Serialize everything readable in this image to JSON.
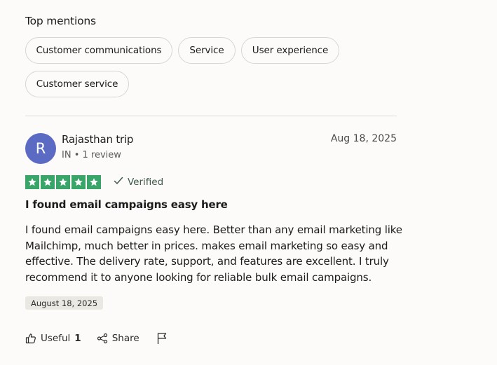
{
  "top_mentions": {
    "title": "Top mentions",
    "chips": [
      "Customer communications",
      "Service",
      "User experience",
      "Customer service"
    ]
  },
  "review": {
    "avatar_initial": "R",
    "author_name": "Rajasthan trip",
    "author_meta": "IN • 1 review",
    "date": "Aug 18, 2025",
    "rating": 5,
    "star_color": "#3aa569",
    "verified_label": "Verified",
    "title": "I found email campaigns easy here",
    "body": "I found email campaigns easy here. Better than any email marketing like Mailchimp, much better in prices. makes email marketing so easy and effective. The delivery rate, support, and features are excellent. I truly recommend it to anyone looking for reliable bulk email campaigns.",
    "experience_date": "August 18, 2025"
  },
  "actions": {
    "useful_label": "Useful",
    "useful_count": "1",
    "share_label": "Share",
    "icons": [
      "thumbs-up-icon",
      "share-icon",
      "flag-icon"
    ]
  }
}
